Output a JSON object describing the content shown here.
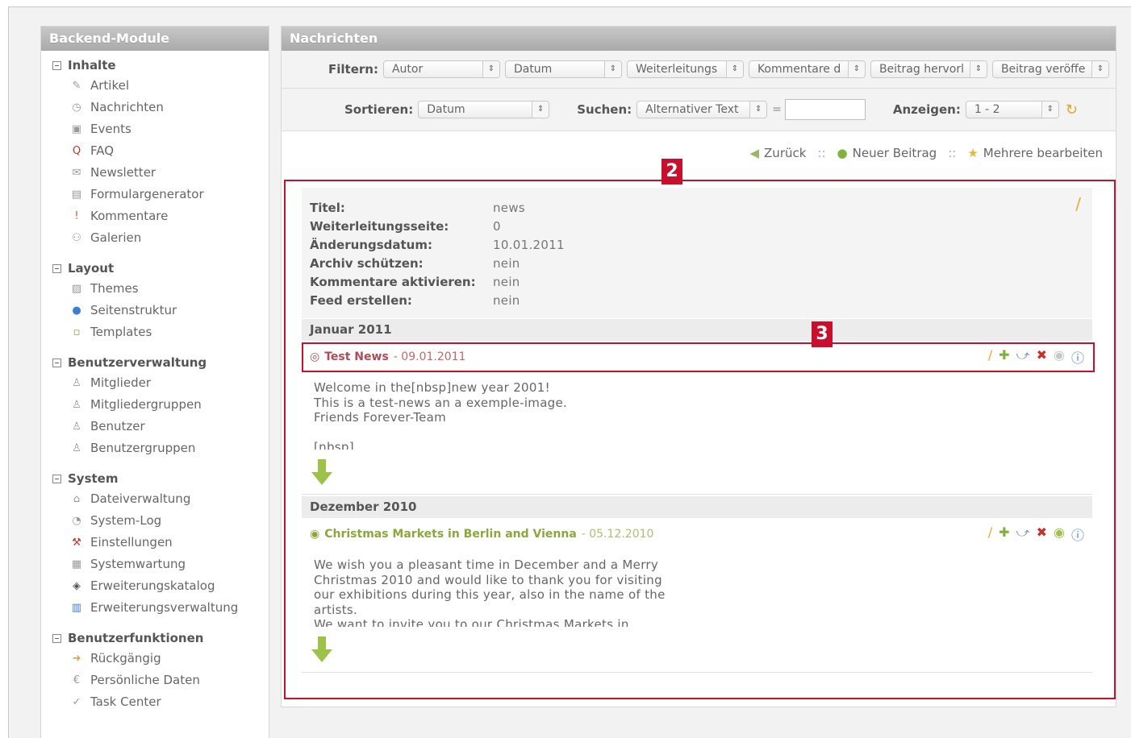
{
  "sidebar": {
    "title": "Backend-Module",
    "groups": [
      {
        "label": "Inhalte",
        "items": [
          {
            "label": "Artikel"
          },
          {
            "label": "Nachrichten"
          },
          {
            "label": "Events"
          },
          {
            "label": "FAQ"
          },
          {
            "label": "Newsletter"
          },
          {
            "label": "Formulargenerator"
          },
          {
            "label": "Kommentare"
          },
          {
            "label": "Galerien"
          }
        ]
      },
      {
        "label": "Layout",
        "items": [
          {
            "label": "Themes"
          },
          {
            "label": "Seitenstruktur"
          },
          {
            "label": "Templates"
          }
        ]
      },
      {
        "label": "Benutzerverwaltung",
        "items": [
          {
            "label": "Mitglieder"
          },
          {
            "label": "Mitgliedergruppen"
          },
          {
            "label": "Benutzer"
          },
          {
            "label": "Benutzergruppen"
          }
        ]
      },
      {
        "label": "System",
        "items": [
          {
            "label": "Dateiverwaltung"
          },
          {
            "label": "System-Log"
          },
          {
            "label": "Einstellungen"
          },
          {
            "label": "Systemwartung"
          },
          {
            "label": "Erweiterungskatalog"
          },
          {
            "label": "Erweiterungsverwaltung"
          }
        ]
      },
      {
        "label": "Benutzerfunktionen",
        "items": [
          {
            "label": "Rückgängig"
          },
          {
            "label": "Persönliche Daten"
          },
          {
            "label": "Task Center"
          }
        ]
      }
    ]
  },
  "main": {
    "title": "Nachrichten",
    "filter": {
      "label": "Filtern:",
      "selects": [
        "Autor",
        "Datum",
        "Weiterleitungs",
        "Kommentare d",
        "Beitrag hervorl",
        "Beitrag veröffe"
      ]
    },
    "sort": {
      "label": "Sortieren:",
      "value": "Datum",
      "search_label": "Suchen:",
      "search_field": "Alternativer Text",
      "equals": "=",
      "show_label": "Anzeigen:",
      "show_value": "1 - 2"
    },
    "actions": {
      "back": "Zurück",
      "sep": "::",
      "new": "Neuer Beitrag",
      "edit_multiple": "Mehrere bearbeiten"
    },
    "details": [
      {
        "key": "Titel:",
        "value": "news"
      },
      {
        "key": "Weiterleitungsseite:",
        "value": "0"
      },
      {
        "key": "Änderungsdatum:",
        "value": "10.01.2011"
      },
      {
        "key": "Archiv schützen:",
        "value": "nein"
      },
      {
        "key": "Kommentare aktivieren:",
        "value": "nein"
      },
      {
        "key": "Feed erstellen:",
        "value": "nein"
      }
    ],
    "months": [
      "Januar 2011",
      "Dezember 2010"
    ],
    "news": [
      {
        "title": "Test News",
        "date": "- 09.01.2011",
        "body": "Welcome in the[nbsp]new year 2001!\nThis is a test-news an a exemple-image.\nFriends Forever-Team\n\n[nbsp]"
      },
      {
        "title": "Christmas Markets in Berlin and Vienna",
        "date": "- 05.12.2010",
        "body": "We wish you a pleasant time in December and a Merry\nChristmas 2010 and would like to thank you for visiting\nour exhibitions during this year, also in the name of the\nartists.\nWe want to invite you to our Christmas Markets in"
      }
    ]
  },
  "annotations": {
    "badge_2": "2",
    "badge_3": "3"
  },
  "colors": {
    "highlight": "#c8102e",
    "header": "#a9a9a9"
  }
}
